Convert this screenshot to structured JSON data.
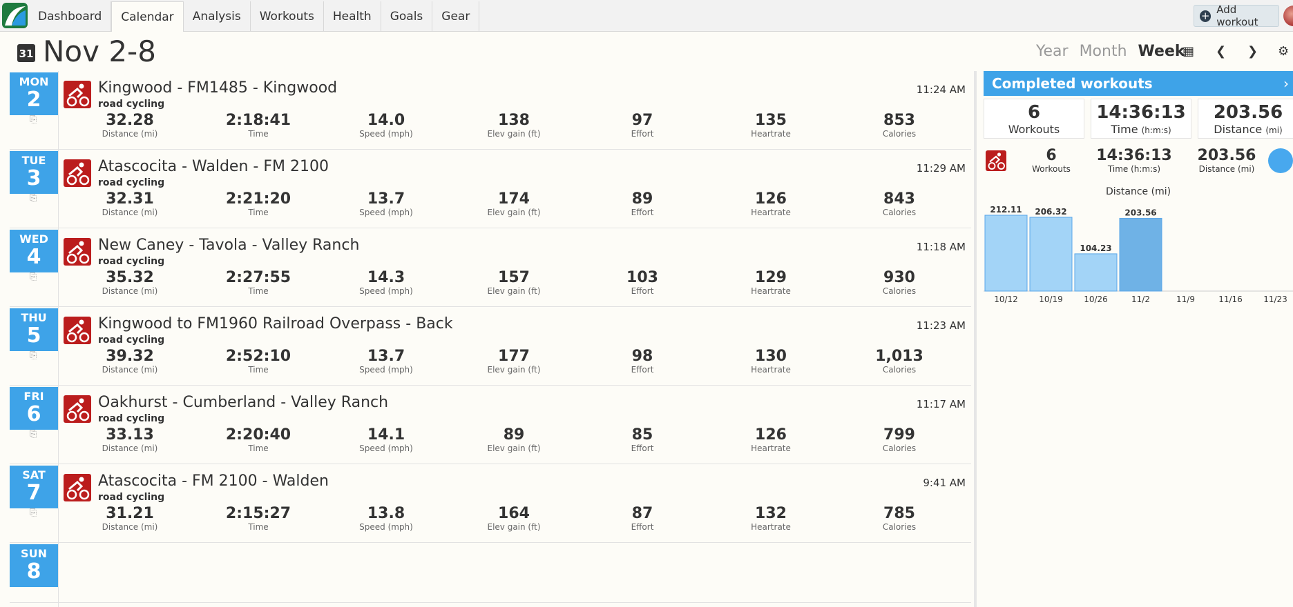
{
  "nav": {
    "tabs": [
      "Dashboard",
      "Calendar",
      "Analysis",
      "Workouts",
      "Health",
      "Goals",
      "Gear"
    ],
    "active": "Calendar",
    "add_workout_label": "Add workout"
  },
  "header": {
    "cal_icon_text": "31",
    "title": "Nov 2-8",
    "views": [
      "Year",
      "Month",
      "Week"
    ],
    "active_view": "Week"
  },
  "days": [
    {
      "dow": "MON",
      "num": "2",
      "workout": {
        "title": "Kingwood - FM1485 - Kingwood",
        "type": "road cycling",
        "time": "11:24 AM",
        "stats": [
          {
            "value": "32.28",
            "label": "Distance (mi)"
          },
          {
            "value": "2:18:41",
            "label": "Time"
          },
          {
            "value": "14.0",
            "label": "Speed (mph)"
          },
          {
            "value": "138",
            "label": "Elev gain (ft)"
          },
          {
            "value": "97",
            "label": "Effort"
          },
          {
            "value": "135",
            "label": "Heartrate"
          },
          {
            "value": "853",
            "label": "Calories"
          }
        ]
      }
    },
    {
      "dow": "TUE",
      "num": "3",
      "workout": {
        "title": "Atascocita - Walden - FM 2100",
        "type": "road cycling",
        "time": "11:29 AM",
        "stats": [
          {
            "value": "32.31",
            "label": "Distance (mi)"
          },
          {
            "value": "2:21:20",
            "label": "Time"
          },
          {
            "value": "13.7",
            "label": "Speed (mph)"
          },
          {
            "value": "174",
            "label": "Elev gain (ft)"
          },
          {
            "value": "89",
            "label": "Effort"
          },
          {
            "value": "126",
            "label": "Heartrate"
          },
          {
            "value": "843",
            "label": "Calories"
          }
        ]
      }
    },
    {
      "dow": "WED",
      "num": "4",
      "workout": {
        "title": "New Caney - Tavola - Valley Ranch",
        "type": "road cycling",
        "time": "11:18 AM",
        "stats": [
          {
            "value": "35.32",
            "label": "Distance (mi)"
          },
          {
            "value": "2:27:55",
            "label": "Time"
          },
          {
            "value": "14.3",
            "label": "Speed (mph)"
          },
          {
            "value": "157",
            "label": "Elev gain (ft)"
          },
          {
            "value": "103",
            "label": "Effort"
          },
          {
            "value": "129",
            "label": "Heartrate"
          },
          {
            "value": "930",
            "label": "Calories"
          }
        ]
      }
    },
    {
      "dow": "THU",
      "num": "5",
      "workout": {
        "title": "Kingwood to FM1960 Railroad Overpass - Back",
        "type": "road cycling",
        "time": "11:23 AM",
        "stats": [
          {
            "value": "39.32",
            "label": "Distance (mi)"
          },
          {
            "value": "2:52:10",
            "label": "Time"
          },
          {
            "value": "13.7",
            "label": "Speed (mph)"
          },
          {
            "value": "177",
            "label": "Elev gain (ft)"
          },
          {
            "value": "98",
            "label": "Effort"
          },
          {
            "value": "130",
            "label": "Heartrate"
          },
          {
            "value": "1,013",
            "label": "Calories"
          }
        ]
      }
    },
    {
      "dow": "FRI",
      "num": "6",
      "workout": {
        "title": "Oakhurst - Cumberland - Valley Ranch",
        "type": "road cycling",
        "time": "11:17 AM",
        "stats": [
          {
            "value": "33.13",
            "label": "Distance (mi)"
          },
          {
            "value": "2:20:40",
            "label": "Time"
          },
          {
            "value": "14.1",
            "label": "Speed (mph)"
          },
          {
            "value": "89",
            "label": "Elev gain (ft)"
          },
          {
            "value": "85",
            "label": "Effort"
          },
          {
            "value": "126",
            "label": "Heartrate"
          },
          {
            "value": "799",
            "label": "Calories"
          }
        ]
      }
    },
    {
      "dow": "SAT",
      "num": "7",
      "workout": {
        "title": "Atascocita - FM 2100 - Walden",
        "type": "road cycling",
        "time": "9:41 AM",
        "stats": [
          {
            "value": "31.21",
            "label": "Distance (mi)"
          },
          {
            "value": "2:15:27",
            "label": "Time"
          },
          {
            "value": "13.8",
            "label": "Speed (mph)"
          },
          {
            "value": "164",
            "label": "Elev gain (ft)"
          },
          {
            "value": "87",
            "label": "Effort"
          },
          {
            "value": "132",
            "label": "Heartrate"
          },
          {
            "value": "785",
            "label": "Calories"
          }
        ]
      }
    },
    {
      "dow": "SUN",
      "num": "8",
      "workout": null
    }
  ],
  "sidebar": {
    "title": "Completed workouts",
    "summary": [
      {
        "value": "6",
        "label": "Workouts",
        "unit": ""
      },
      {
        "value": "14:36:13",
        "label": "Time",
        "unit": "(h:m:s)"
      },
      {
        "value": "203.56",
        "label": "Distance",
        "unit": "(mi)"
      }
    ],
    "sub": [
      {
        "value": "6",
        "label": "Workouts"
      },
      {
        "value": "14:36:13",
        "label": "Time (h:m:s)"
      },
      {
        "value": "203.56",
        "label": "Distance (mi)"
      }
    ]
  },
  "chart_data": {
    "type": "bar",
    "title": "Distance (mi)",
    "categories": [
      "10/12",
      "10/19",
      "10/26",
      "11/2",
      "11/9",
      "11/16",
      "11/23"
    ],
    "values": [
      212.11,
      206.32,
      104.23,
      203.56,
      null,
      null,
      null
    ],
    "value_labels": [
      "212.11",
      "206.32",
      "104.23",
      "203.56"
    ],
    "highlight_index": 3,
    "colors": {
      "bar": "#a3d4f7",
      "highlight": "#6fb2e6",
      "bar_border": "#5aa6e8"
    }
  }
}
